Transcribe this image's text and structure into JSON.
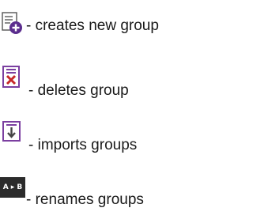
{
  "legend": {
    "items": [
      {
        "icon": "new-group-icon",
        "label": "- creates new group"
      },
      {
        "icon": "delete-group-icon",
        "label": "- deletes group"
      },
      {
        "icon": "import-groups-icon",
        "label": "- imports groups"
      },
      {
        "icon": "rename-groups-icon",
        "icon_text": "A ▸ B",
        "label": "- renames groups"
      }
    ]
  },
  "colors": {
    "new_accent": "#5b2d8e",
    "delete_accent": "#c62828",
    "frame_accent": "#7b3fa0",
    "rename_bg": "#2b2b2b"
  }
}
